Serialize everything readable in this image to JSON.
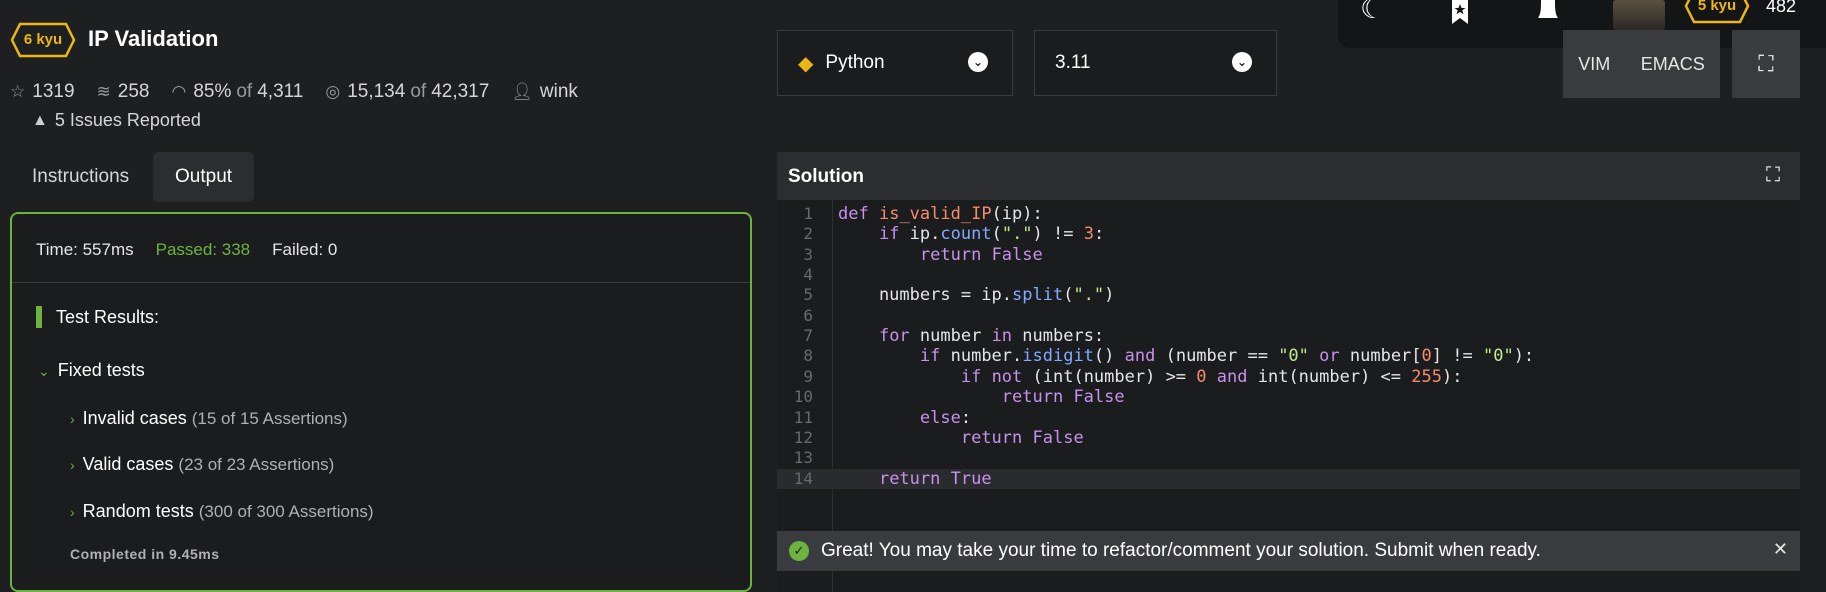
{
  "kata": {
    "rank": "6 kyu",
    "title": "IP Validation",
    "stats": {
      "stars": "1319",
      "collections": "258",
      "satisfaction": "85%",
      "satisfaction_of": "of",
      "satisfaction_votes": "4,311",
      "completions": "15,134",
      "completions_of": "of",
      "attempts": "42,317",
      "author": "wink"
    },
    "issues": "5 Issues Reported"
  },
  "tabs": {
    "instructions": "Instructions",
    "output": "Output"
  },
  "output": {
    "time": "Time: 557ms",
    "passed": "Passed: 338",
    "failed": "Failed: 0",
    "results_heading": "Test Results:",
    "group": "Fixed tests",
    "cases": [
      {
        "name": "Invalid cases",
        "count": "(15 of 15 Assertions)"
      },
      {
        "name": "Valid cases",
        "count": "(23 of 23 Assertions)"
      },
      {
        "name": "Random tests",
        "count": "(300 of 300 Assertions)"
      }
    ],
    "completed": "Completed in 9.45ms"
  },
  "editor": {
    "language": "Python",
    "version": "3.11",
    "modes": {
      "vim": "VIM",
      "emacs": "EMACS"
    },
    "panel_title": "Solution",
    "code_lines": [
      "def is_valid_IP(ip):",
      "    if ip.count(\".\") != 3:",
      "        return False",
      "",
      "    numbers = ip.split(\".\")",
      "",
      "    for number in numbers:",
      "        if number.isdigit() and (number == \"0\" or number[0] != \"0\"):",
      "            if not (int(number) >= 0 and int(number) <= 255):",
      "                return False",
      "        else:",
      "            return False",
      "",
      "    return True"
    ],
    "line_numbers": [
      "1",
      "2",
      "3",
      "4",
      "5",
      "6",
      "7",
      "8",
      "9",
      "10",
      "11",
      "12",
      "13",
      "14"
    ]
  },
  "user": {
    "rank": "5 kyu",
    "honor": "482"
  },
  "toast": {
    "message": "Great! You may take your time to refactor/comment your solution. Submit when ready."
  },
  "colors": {
    "accent_green": "#6db33f",
    "rank_yellow": "#ecb613",
    "background": "#1e1f21"
  },
  "icons": [
    "star-icon",
    "collections-icon",
    "satisfaction-icon",
    "target-icon",
    "user-icon",
    "warning-icon",
    "python-icon",
    "moon-icon",
    "bookmark-icon",
    "bell-icon",
    "expand-icon",
    "check-icon",
    "close-icon"
  ]
}
